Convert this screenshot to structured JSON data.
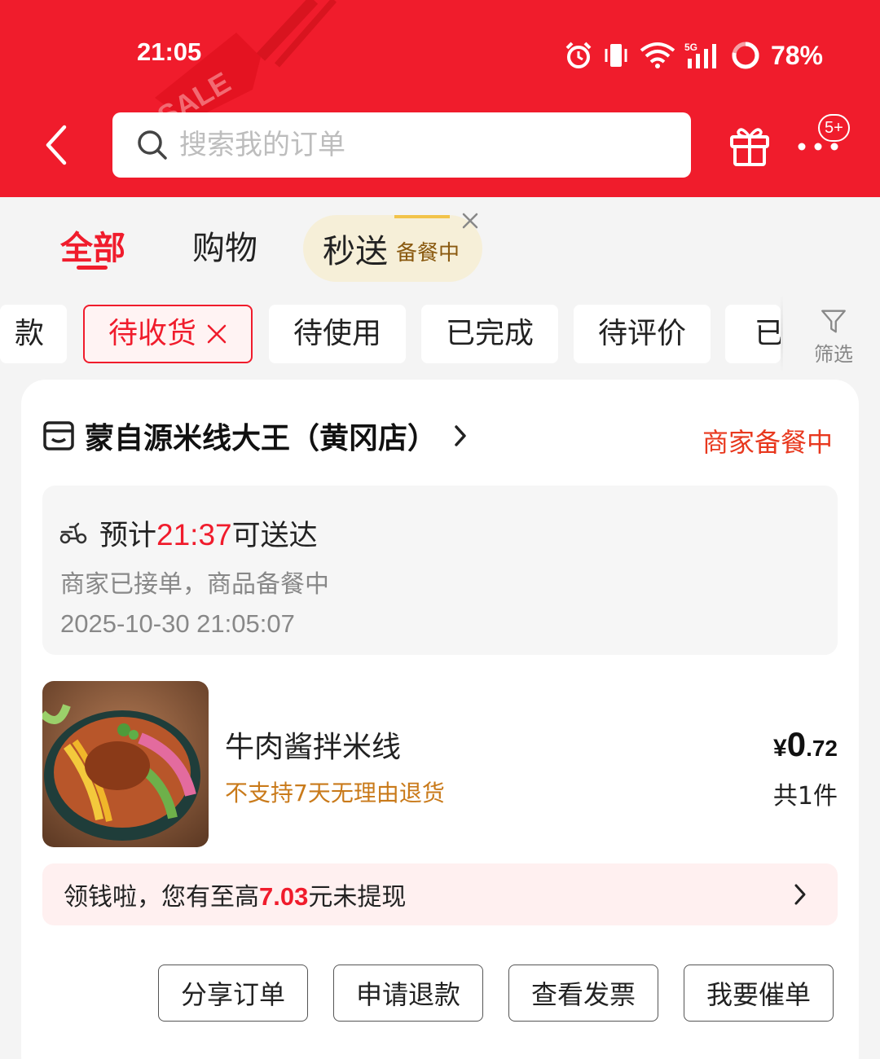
{
  "status_bar": {
    "time": "21:05",
    "battery": "78%",
    "icons": [
      "alarm-icon",
      "vibrate-icon",
      "wifi-icon",
      "5g-signal-icon",
      "battery-ring-icon"
    ]
  },
  "header": {
    "search_placeholder": "搜索我的订单",
    "more_badge": "5+",
    "decoration_text": "SALE"
  },
  "tabs": {
    "all": "全部",
    "shopping": "购物",
    "express": "秒送",
    "express_sub": "备餐中"
  },
  "filters": {
    "partial_left": "款",
    "active": "待收货",
    "items": [
      "待使用",
      "已完成",
      "待评价"
    ],
    "partial_right": "已",
    "filter_label": "筛选"
  },
  "order": {
    "store_name": "蒙自源米线大王（黄冈店）",
    "store_status": "商家备餐中",
    "eta_prefix": "预计",
    "eta_time": "21:37",
    "eta_suffix": "可送达",
    "progress": "商家已接单，商品备餐中",
    "timestamp": "2025-10-30 21:05:07",
    "product": {
      "name": "牛肉酱拌米线",
      "note": "不支持7天无理由退货",
      "price_symbol": "¥",
      "price_int": "0",
      "price_dec": ".72",
      "quantity": "共1件"
    },
    "cash_banner": {
      "prefix": "领钱啦，您有至高",
      "amount": "7.03",
      "suffix": "元未提现"
    },
    "actions": [
      "分享订单",
      "申请退款",
      "查看发票",
      "我要催单"
    ]
  },
  "colors": {
    "brand_red": "#f01c2c",
    "status_orange": "#e8381e",
    "note_orange": "#c97a1a"
  }
}
